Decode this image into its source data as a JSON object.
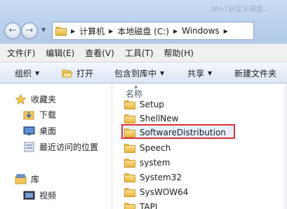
{
  "title_blur": "Win7自定义磁盘...",
  "address": {
    "crumbs": [
      "计算机",
      "本地磁盘 (C:)",
      "Windows"
    ]
  },
  "menu": [
    "文件(F)",
    "编辑(E)",
    "查看(V)",
    "工具(T)",
    "帮助(H)"
  ],
  "commands": {
    "organize": "组织",
    "open": "打开",
    "include_in_library": "包含到库中",
    "share": "共享",
    "new_folder": "新建文件夹"
  },
  "nav": {
    "favorites": "收藏夹",
    "downloads": "下载",
    "desktop": "桌面",
    "recent": "最近访问的位置",
    "libraries": "库",
    "videos": "视频"
  },
  "content": {
    "column_header": "名称",
    "files": [
      "Setup",
      "ShellNew",
      "SoftwareDistribution",
      "Speech",
      "system",
      "System32",
      "SysWOW64",
      "TAPI"
    ],
    "selected_index": 2
  },
  "colors": {
    "highlight_border": "#e0303a",
    "selection_fill": "#e6f0fb",
    "folder_yellow": "#f2c65a"
  },
  "icons": [
    "star-icon",
    "folder-icon",
    "desktop-icon",
    "recent-places-icon",
    "library-icon",
    "video-icon",
    "open-icon"
  ]
}
